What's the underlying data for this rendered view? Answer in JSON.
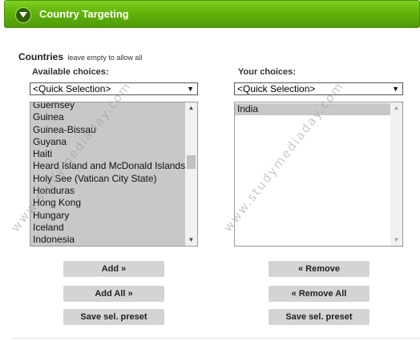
{
  "panel": {
    "title": "Country Targeting",
    "toggle_icon": "chevron-down-icon"
  },
  "countries": {
    "label": "Countries",
    "hint": "leave empty to allow all"
  },
  "available": {
    "label": "Available choices:",
    "quick_selection": "<Quick Selection>",
    "items": [
      "Guernsey",
      "Guinea",
      "Guinea-Bissau",
      "Guyana",
      "Haiti",
      "Heard Island and McDonald Islands",
      "Holy See (Vatican City State)",
      "Honduras",
      "Hong Kong",
      "Hungary",
      "Iceland",
      "Indonesia"
    ]
  },
  "chosen": {
    "label": "Your choices:",
    "quick_selection": "<Quick Selection>",
    "items": [
      "India"
    ]
  },
  "buttons": {
    "add": "Add »",
    "add_all": "Add All »",
    "save_preset_left": "Save sel. preset",
    "remove": "« Remove",
    "remove_all": "« Remove All",
    "save_preset_right": "Save sel. preset"
  },
  "watermark": "www.studymediaday.com"
}
